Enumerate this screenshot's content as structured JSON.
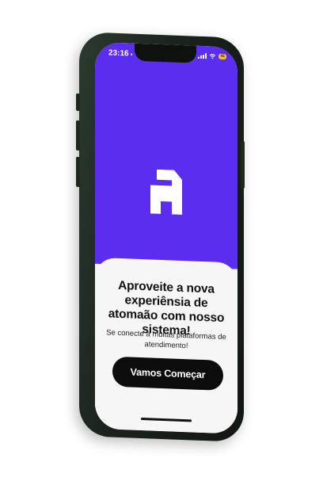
{
  "status_bar": {
    "time": "23:16",
    "location_glyph": "◐",
    "battery": "41"
  },
  "logo": {
    "icon": "brand-a-icon",
    "color": "#ffffff"
  },
  "colors": {
    "accent": "#5a2df0",
    "button": "#0c0c0c",
    "sheet": "#f6f6f6"
  },
  "onboarding": {
    "headline": "Aproveite a nova experiênsia de atomaão com nosso sistema!",
    "subtitle": "Se conecte a muitas plataformas de atendimento!",
    "cta_label": "Vamos Começar"
  }
}
